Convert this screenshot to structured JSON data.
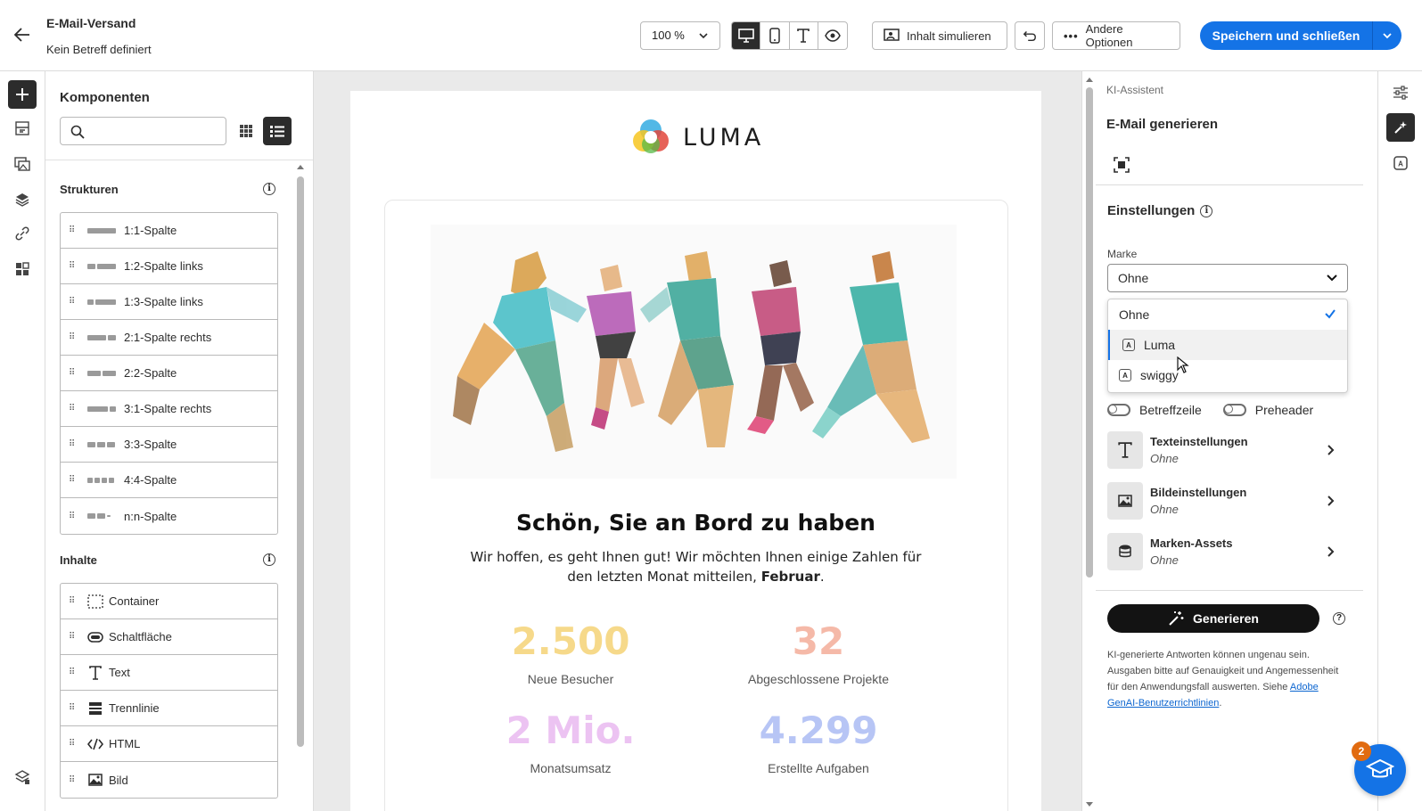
{
  "header": {
    "title": "E-Mail-Versand",
    "subtitle": "Kein Betreff definiert",
    "zoom": "100 %",
    "simulate_label": "Inhalt simulieren",
    "more_options_label": "Andere Optionen",
    "save_label": "Speichern und schließen"
  },
  "components": {
    "title": "Komponenten",
    "search_placeholder": "",
    "structures_title": "Strukturen",
    "structures": [
      "1:1-Spalte",
      "1:2-Spalte links",
      "1:3-Spalte links",
      "2:1-Spalte rechts",
      "2:2-Spalte",
      "3:1-Spalte rechts",
      "3:3-Spalte",
      "4:4-Spalte",
      "n:n-Spalte"
    ],
    "contents_title": "Inhalte",
    "contents": [
      "Container",
      "Schaltfläche",
      "Text",
      "Trennlinie",
      "HTML",
      "Bild"
    ]
  },
  "email": {
    "logo_text": "LUMA",
    "headline": "Schön, Sie an Bord zu haben",
    "body_part1": "Wir hoffen, es geht Ihnen gut! Wir möchten Ihnen einige Zahlen für den letzten Monat mitteilen,",
    "body_bold": "Februar",
    "body_end": ".",
    "stats": [
      {
        "value": "2.500",
        "label": "Neue Besucher",
        "color": "#f6d98a"
      },
      {
        "value": "32",
        "label": "Abgeschlossene Projekte",
        "color": "#f5b9a8"
      },
      {
        "value": "2 Mio.",
        "label": "Monatsumsatz",
        "color": "#ecc3f2"
      },
      {
        "value": "4.299",
        "label": "Erstellte Aufgaben",
        "color": "#b7c5f5"
      }
    ]
  },
  "ai_panel": {
    "breadcrumb": "KI-Assistent",
    "title": "E-Mail generieren",
    "settings_title": "Einstellungen",
    "brand_label": "Marke",
    "brand_selected": "Ohne",
    "brand_options": [
      "Ohne",
      "Luma",
      "swiggy"
    ],
    "toggle_subject": "Betreffzeile",
    "toggle_preheader": "Preheader",
    "settings_rows": [
      {
        "title": "Texteinstellungen",
        "value": "Ohne"
      },
      {
        "title": "Bildeinstellungen",
        "value": "Ohne"
      },
      {
        "title": "Marken-Assets",
        "value": "Ohne"
      }
    ],
    "generate_label": "Generieren",
    "disclaimer": "KI-generierte Antworten können ungenau sein. Ausgaben bitte auf Genauigkeit und Angemessenheit für den Anwendungsfall auswerten. Siehe",
    "disclaimer_link": "Adobe GenAI-Benutzerrichtlinien",
    "disclaimer_end": "."
  },
  "coach_badge_count": "2",
  "colors": {
    "accent": "#1473e6",
    "dark": "#2c2c2c",
    "badge": "#e16b10"
  }
}
